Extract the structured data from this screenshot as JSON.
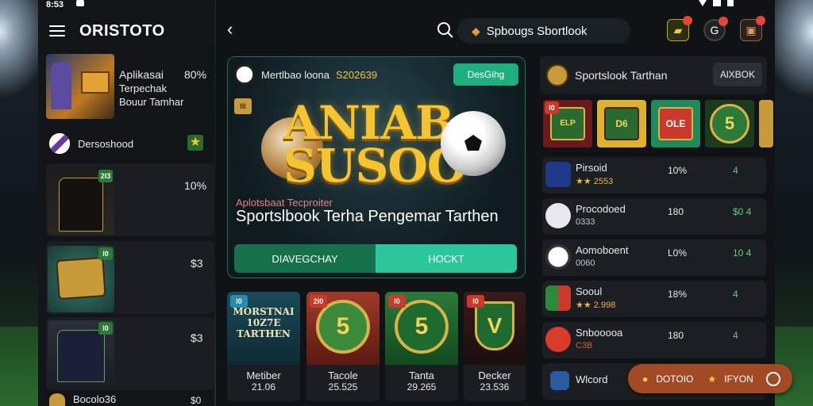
{
  "status": {
    "time": "8:53"
  },
  "left": {
    "brand": "ORISTOTO",
    "promo": {
      "line1": "Aplikasai",
      "line2": "Terpechak",
      "line3": "Bouur Tamhar",
      "pct": "80%"
    },
    "section": {
      "label": "Dersoshood"
    },
    "cards": [
      {
        "badge": "2l3",
        "pct": "10%"
      },
      {
        "badge": "l0",
        "pct": "$3"
      },
      {
        "badge": "l0",
        "pct": "$3"
      }
    ],
    "bottom": {
      "label": "Bocolo36",
      "pct": "$0"
    }
  },
  "header": {
    "search_text": "Spbougs Sbortlook"
  },
  "hero": {
    "title_small": "Mertlbao loona",
    "code": "S202639",
    "button": "DesGihg",
    "badge": "lll",
    "logo_line1": "ANIAB",
    "logo_line2": "SUSOO",
    "subtitle": "Aplotsbaat Tecproiter",
    "headline": "Sportslbook Terha Pengemar Tarthen",
    "seg_left": "DIAVEGCHAY",
    "seg_right": "HOCKT"
  },
  "games": [
    {
      "badge": "l0",
      "art": "MORSTNAI 10Z7E TARTHEN",
      "name": "Metiber",
      "value": "21.06"
    },
    {
      "badge": "2l0",
      "art": "5",
      "name": "Tacole",
      "value": "25.525"
    },
    {
      "badge": "l0",
      "art": "5",
      "name": "Tanta",
      "value": "29.265"
    },
    {
      "badge": "l0",
      "art": "V",
      "name": "Decker",
      "value": "23.536"
    }
  ],
  "side": {
    "title": "Sportslook Tarthan",
    "button": "AlXBOK",
    "tiles": [
      {
        "badge": "l0",
        "art": "ELP"
      },
      {
        "badge": "",
        "art": "D6"
      },
      {
        "badge": "",
        "art": "OLE"
      },
      {
        "badge": "",
        "art": "5"
      }
    ],
    "rows": [
      {
        "name": "Pirsoid",
        "sub": "★★ 2553",
        "pct": "10%",
        "rate": "4"
      },
      {
        "name": "Procodoed",
        "sub": "0333",
        "pct": "180",
        "rate": "$0 4"
      },
      {
        "name": "Aomoboent",
        "sub": "0060",
        "pct": "L0%",
        "rate": "10 4"
      },
      {
        "name": "Sooul",
        "sub": "★★ 2.998",
        "pct": "18%",
        "rate": "4"
      },
      {
        "name": "Snbooooa",
        "sub": "C3B",
        "pct": "180",
        "rate": "4"
      },
      {
        "name": "Wlcord",
        "sub": "",
        "pct": "",
        "rate": ""
      }
    ]
  },
  "float_pill": {
    "left": "DOTOIO",
    "right": "IFYON"
  }
}
